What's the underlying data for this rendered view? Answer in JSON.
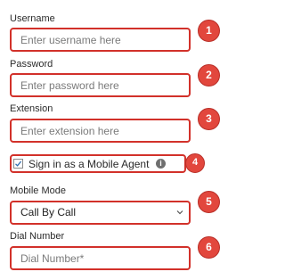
{
  "username": {
    "label": "Username",
    "placeholder": "Enter username here",
    "badge": "1"
  },
  "password": {
    "label": "Password",
    "placeholder": "Enter password here",
    "badge": "2"
  },
  "extension": {
    "label": "Extension",
    "placeholder": "Enter extension here",
    "badge": "3"
  },
  "mobile_agent": {
    "label": "Sign in as a Mobile Agent",
    "checked": true,
    "info_icon": "info-icon",
    "info_glyph": "i",
    "badge": "4"
  },
  "mobile_mode": {
    "label": "Mobile Mode",
    "selected": "Call By Call",
    "badge": "5"
  },
  "dial_number": {
    "label": "Dial Number",
    "placeholder": "Dial Number*",
    "badge": "6"
  },
  "colors": {
    "annotation": "#e2473d",
    "highlight_border": "#d2312a"
  }
}
